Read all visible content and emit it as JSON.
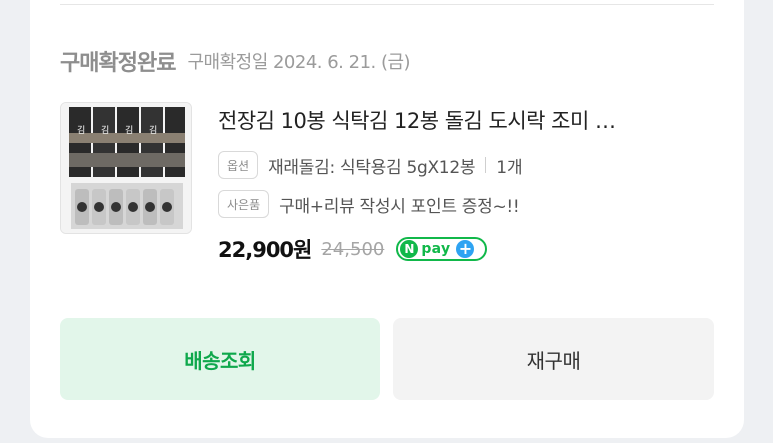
{
  "order": {
    "status": "구매확정완료",
    "confirm_date": "구매확정일 2024. 6. 21. (금)"
  },
  "product": {
    "title": "전장김 10봉 식탁김 12봉 돌김 도시락 조미 …",
    "option_tag": "옵션",
    "option_text": "재래돌김: 식탁용김 5gX12봉",
    "quantity": "1개",
    "gift_tag": "사은품",
    "gift_text": "구매+리뷰 작성시 포인트 증정~!!",
    "price": "22,900원",
    "original_price": "24,500",
    "npay_badge": {
      "n": "N",
      "text": "pay",
      "plus": "+"
    },
    "thumbnail_icon": "seaweed-product-image"
  },
  "buttons": {
    "track_label": "배송조회",
    "rebuy_label": "재구매"
  },
  "colors": {
    "accent_green": "#0fa84c",
    "track_bg": "#e2f6ea",
    "npay_green": "#11b84a",
    "npay_plus_blue": "#2ea3f2"
  }
}
